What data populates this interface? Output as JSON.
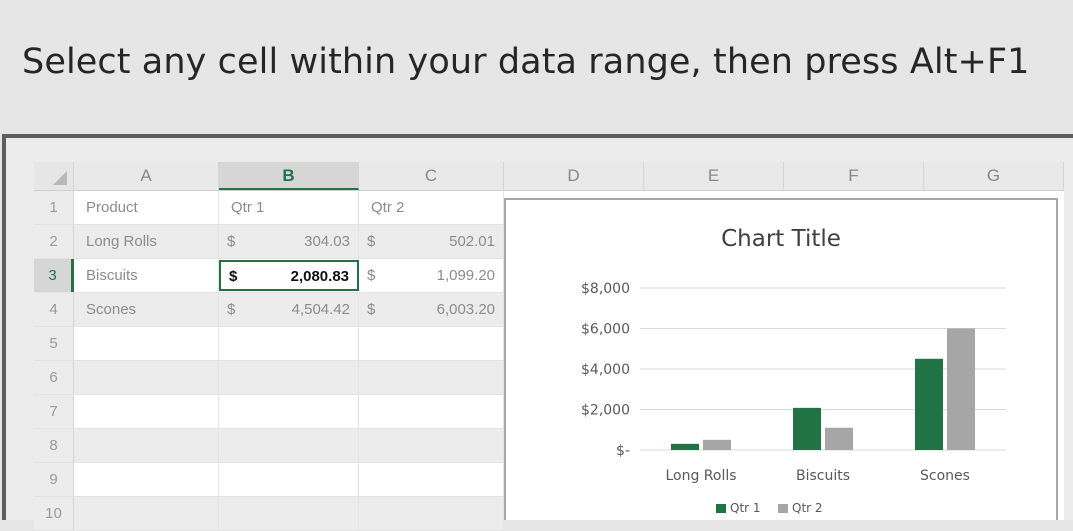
{
  "instruction": "Select any cell within your data range, then press Alt+F1",
  "columns": [
    "A",
    "B",
    "C",
    "D",
    "E",
    "F",
    "G"
  ],
  "rows": [
    {
      "num": "1",
      "a": "Product",
      "b_cur": "",
      "b": "Qtr 1",
      "c_cur": "",
      "c": "Qtr 2"
    },
    {
      "num": "2",
      "a": "Long Rolls",
      "b_cur": "$",
      "b": "304.03",
      "c_cur": "$",
      "c": "502.01"
    },
    {
      "num": "3",
      "a": "Biscuits",
      "b_cur": "$",
      "b": "2,080.83",
      "c_cur": "$",
      "c": "1,099.20"
    },
    {
      "num": "4",
      "a": "Scones",
      "b_cur": "$",
      "b": "4,504.42",
      "c_cur": "$",
      "c": "6,003.20"
    },
    {
      "num": "5",
      "a": "",
      "b_cur": "",
      "b": "",
      "c_cur": "",
      "c": ""
    },
    {
      "num": "6",
      "a": "",
      "b_cur": "",
      "b": "",
      "c_cur": "",
      "c": ""
    },
    {
      "num": "7",
      "a": "",
      "b_cur": "",
      "b": "",
      "c_cur": "",
      "c": ""
    },
    {
      "num": "8",
      "a": "",
      "b_cur": "",
      "b": "",
      "c_cur": "",
      "c": ""
    },
    {
      "num": "9",
      "a": "",
      "b_cur": "",
      "b": "",
      "c_cur": "",
      "c": ""
    },
    {
      "num": "10",
      "a": "",
      "b_cur": "",
      "b": "",
      "c_cur": "",
      "c": ""
    }
  ],
  "selection": {
    "column": "B",
    "row": "3"
  },
  "chart_data": {
    "type": "bar",
    "title": "Chart Title",
    "categories": [
      "Long Rolls",
      "Biscuits",
      "Scones"
    ],
    "series": [
      {
        "name": "Qtr 1",
        "values": [
          304.03,
          2080.83,
          4504.42
        ],
        "color": "#217346"
      },
      {
        "name": "Qtr 2",
        "values": [
          502.01,
          1099.2,
          6003.2
        ],
        "color": "#a6a6a6"
      }
    ],
    "yticks": [
      "$-",
      "$2,000",
      "$4,000",
      "$6,000",
      "$8,000"
    ],
    "ylim": [
      0,
      8000
    ],
    "grid": true,
    "legend": "bottom"
  },
  "colors": {
    "accent": "#217346",
    "series2": "#a6a6a6"
  }
}
